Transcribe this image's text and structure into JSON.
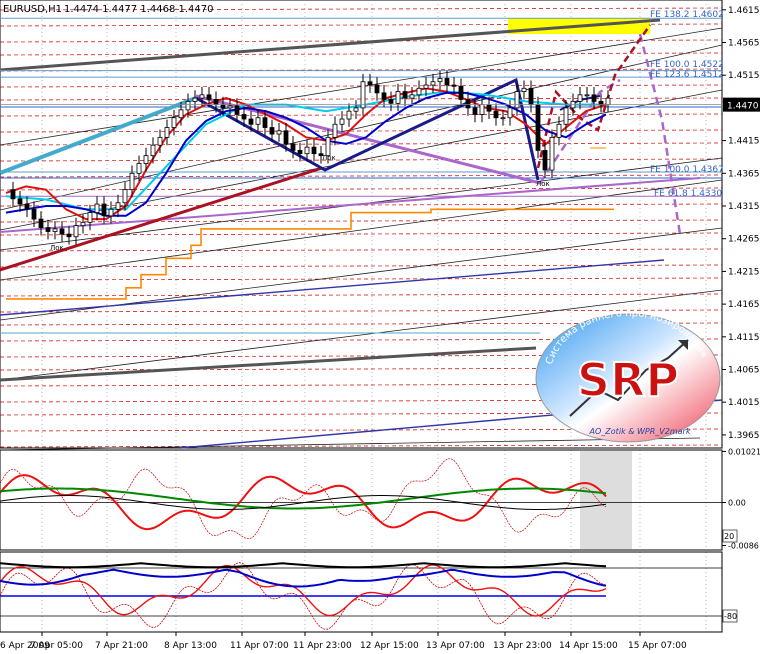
{
  "header": {
    "symbol": "EURUSD,H1",
    "quote": "1.4474 1.4477 1.4468 1.4470"
  },
  "colors": {
    "bg": "#ffffff",
    "grid": "#000000",
    "price_line": "#000000",
    "red_dashed": "#cc0000",
    "blue": "#0000cc",
    "cyan": "#00ccee",
    "magenta": "#cc00cc",
    "orange": "#ff8800",
    "teal": "#44aacc",
    "violet": "#aa66cc",
    "maroon": "#aa1122",
    "green": "#008800",
    "highlight": "#ffff00",
    "fib_text": "#3366cc"
  },
  "chart_data": [
    {
      "id": "main",
      "type": "line",
      "title": "EURUSD,H1",
      "ylim": [
        1.3945,
        1.463
      ],
      "price_axis_ticks": [
        "1.4615",
        "1.4565",
        "1.4515",
        "1.4470",
        "1.4415",
        "1.4365",
        "1.4315",
        "1.4265",
        "1.4215",
        "1.4165",
        "1.4115",
        "1.4065",
        "1.4015",
        "1.3965"
      ],
      "current_price": "1.4470",
      "fibo_labels": [
        "FE 138.2 1.4602",
        "FE 100.0 1.4522",
        "FE 123.6 1.4512",
        "FE 100.0 1.4367",
        "FE 61.8 1.4330"
      ],
      "fibo_levels": [
        1.4602,
        1.4522,
        1.4512,
        1.4367,
        1.433
      ],
      "high_low_labels": [
        "Лок",
        "Лок",
        "Лок"
      ],
      "close_series": {
        "x": [
          0,
          7,
          14,
          21,
          28,
          35,
          42,
          49,
          56,
          63,
          70,
          77,
          84,
          91,
          98,
          105,
          112,
          119,
          126,
          133,
          140,
          147,
          154,
          161,
          168,
          175,
          182,
          189,
          196,
          203,
          210,
          217,
          224,
          231,
          238,
          245,
          252,
          259,
          266,
          273,
          280,
          287,
          294,
          301,
          308,
          315,
          322,
          329,
          336,
          343,
          350,
          357,
          364,
          371,
          378,
          385,
          392,
          399,
          406,
          413,
          420,
          427,
          434,
          441,
          448,
          455,
          462,
          469,
          476,
          483,
          490,
          497,
          504,
          511,
          518,
          525,
          532,
          539,
          546,
          553,
          560,
          567,
          574,
          581,
          588,
          595,
          602
        ],
        "y": [
          1.434,
          1.4326,
          1.4318,
          1.431,
          1.4295,
          1.4282,
          1.4276,
          1.428,
          1.4272,
          1.4268,
          1.4285,
          1.429,
          1.4305,
          1.4318,
          1.43,
          1.431,
          1.432,
          1.434,
          1.4365,
          1.438,
          1.4392,
          1.4408,
          1.442,
          1.4435,
          1.445,
          1.4462,
          1.4475,
          1.448,
          1.4485,
          1.4478,
          1.447,
          1.4465,
          1.4468,
          1.4455,
          1.4448,
          1.444,
          1.445,
          1.4435,
          1.4425,
          1.443,
          1.441,
          1.44,
          1.4395,
          1.4405,
          1.4395,
          1.4392,
          1.442,
          1.444,
          1.4448,
          1.446,
          1.4465,
          1.4505,
          1.45,
          1.4488,
          1.4478,
          1.4472,
          1.449,
          1.448,
          1.4485,
          1.4495,
          1.45,
          1.4505,
          1.451,
          1.45,
          1.4498,
          1.4478,
          1.4465,
          1.4455,
          1.447,
          1.446,
          1.445,
          1.445,
          1.4465,
          1.449,
          1.4495,
          1.447,
          1.44,
          1.437,
          1.442,
          1.444,
          1.4465,
          1.4475,
          1.4485,
          1.4485,
          1.4475,
          1.447,
          1.448,
          1.447
        ]
      },
      "red_ma": {
        "x": [
          0,
          20,
          40,
          60,
          80,
          100,
          120,
          140,
          160,
          180,
          200,
          220,
          240,
          260,
          280,
          300,
          320,
          340,
          360,
          380,
          400,
          420,
          440,
          460,
          480,
          500,
          520,
          540,
          560,
          580,
          600
        ],
        "y": [
          1.4335,
          1.4345,
          1.434,
          1.431,
          1.4295,
          1.4295,
          1.4315,
          1.437,
          1.442,
          1.4455,
          1.447,
          1.448,
          1.447,
          1.4455,
          1.444,
          1.442,
          1.4415,
          1.4425,
          1.4455,
          1.448,
          1.4488,
          1.4495,
          1.449,
          1.4478,
          1.4465,
          1.446,
          1.444,
          1.441,
          1.4435,
          1.446,
          1.447
        ]
      },
      "blue_ma": {
        "x": [
          0,
          20,
          40,
          60,
          80,
          100,
          120,
          140,
          160,
          180,
          200,
          220,
          240,
          260,
          280,
          300,
          320,
          340,
          360,
          380,
          400,
          420,
          440,
          460,
          480,
          500,
          520,
          540,
          560,
          580,
          600
        ],
        "y": [
          1.4305,
          1.431,
          1.4315,
          1.4315,
          1.431,
          1.43,
          1.43,
          1.432,
          1.4365,
          1.4415,
          1.4445,
          1.446,
          1.4465,
          1.446,
          1.445,
          1.4435,
          1.4415,
          1.441,
          1.442,
          1.4445,
          1.4465,
          1.448,
          1.4488,
          1.4488,
          1.448,
          1.447,
          1.4455,
          1.443,
          1.442,
          1.444,
          1.4455
        ]
      },
      "cyan_ma": {
        "x": [
          0,
          40,
          80,
          120,
          160,
          200,
          240,
          280,
          320,
          360,
          400,
          440,
          480,
          520,
          560,
          600
        ],
        "y": [
          1.433,
          1.4325,
          1.431,
          1.431,
          1.4375,
          1.444,
          1.447,
          1.447,
          1.446,
          1.447,
          1.4482,
          1.449,
          1.4485,
          1.4475,
          1.447,
          1.447
        ]
      },
      "orange_step": {
        "x": [
          0,
          120,
          120,
          135,
          135,
          160,
          160,
          185,
          185,
          195,
          195,
          345,
          345,
          425,
          425,
          608
        ],
        "y": [
          1.4173,
          1.4173,
          1.419,
          1.419,
          1.421,
          1.421,
          1.4235,
          1.4235,
          1.4255,
          1.4255,
          1.428,
          1.428,
          1.4305,
          1.4305,
          1.431,
          1.431
        ]
      }
    },
    {
      "id": "oscillator-1",
      "type": "line",
      "price_axis_ticks": [
        "0.01021",
        "0.00",
        "-0.0086"
      ],
      "ylim": [
        -0.0095,
        0.0105
      ]
    },
    {
      "id": "oscillator-2",
      "type": "line",
      "price_axis_ticks": [
        "20",
        "-80"
      ],
      "ylim": [
        -100,
        0
      ]
    }
  ],
  "time_axis": [
    "6 Apr 2009",
    "7 Apr 05:00",
    "7 Apr 21:00",
    "8 Apr 13:00",
    "11 Apr 07:00",
    "11 Apr 23:00",
    "12 Apr 15:00",
    "13 Apr 07:00",
    "13 Apr 23:00",
    "14 Apr 15:00",
    "15 Apr 07:00"
  ],
  "logo": {
    "text_main": "SRP",
    "text_arc": "Система раннего прогнозирования",
    "text_bottom": "АО_Zotik & WPR_V2mark"
  }
}
